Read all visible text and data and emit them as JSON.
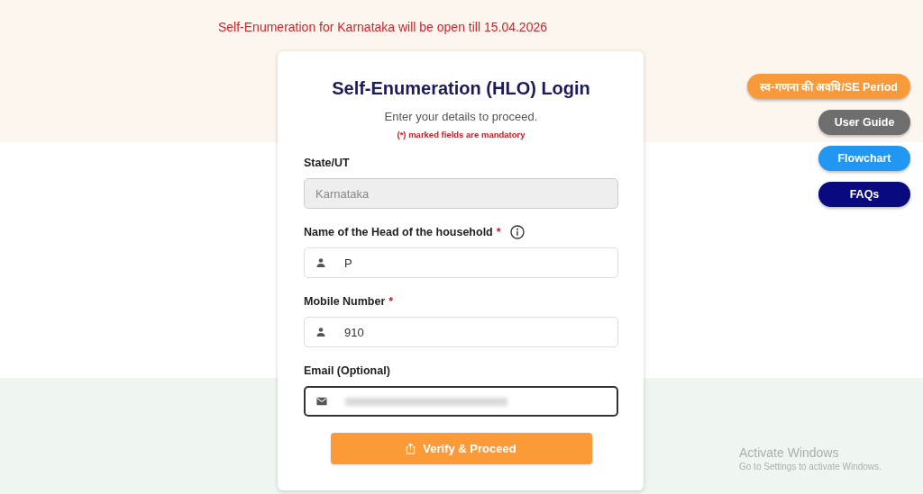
{
  "notice": "Self-Enumeration for Karnataka will be open till 15.04.2026",
  "login": {
    "title": "Self-Enumeration (HLO) Login",
    "subtitle": "Enter your details to proceed.",
    "mandatory_note": "(*) marked fields are mandatory",
    "fields": [
      {
        "kind": "plain",
        "label": "State/UT",
        "value": "Karnataka",
        "disabled": true,
        "focused": false,
        "value_hidden": false
      },
      {
        "kind": "person",
        "label": "Name of the Head of the household",
        "required_mark": "*",
        "value": "P",
        "info": true,
        "disabled": false,
        "focused": false,
        "value_hidden": false
      },
      {
        "kind": "person",
        "label": "Mobile Number",
        "required_mark": "*",
        "value": "910",
        "disabled": false,
        "focused": false,
        "value_hidden": false
      },
      {
        "kind": "mail",
        "label": "Email (Optional)",
        "disabled": false,
        "focused": true,
        "value_hidden": true
      }
    ],
    "submit": "Verify & Proceed"
  },
  "side_buttons": [
    {
      "label": "स्व-गणना की अवधि/SE Period",
      "color": "#f99a3a"
    },
    {
      "label": "User Guide",
      "color": "#6e6e6e"
    },
    {
      "label": "Flowchart",
      "color": "#2196f3"
    },
    {
      "label": "FAQs",
      "color": "#0a0a80"
    }
  ],
  "os_notice": {
    "title": "Activate Windows",
    "text": "Go to Settings to activate Windows."
  }
}
